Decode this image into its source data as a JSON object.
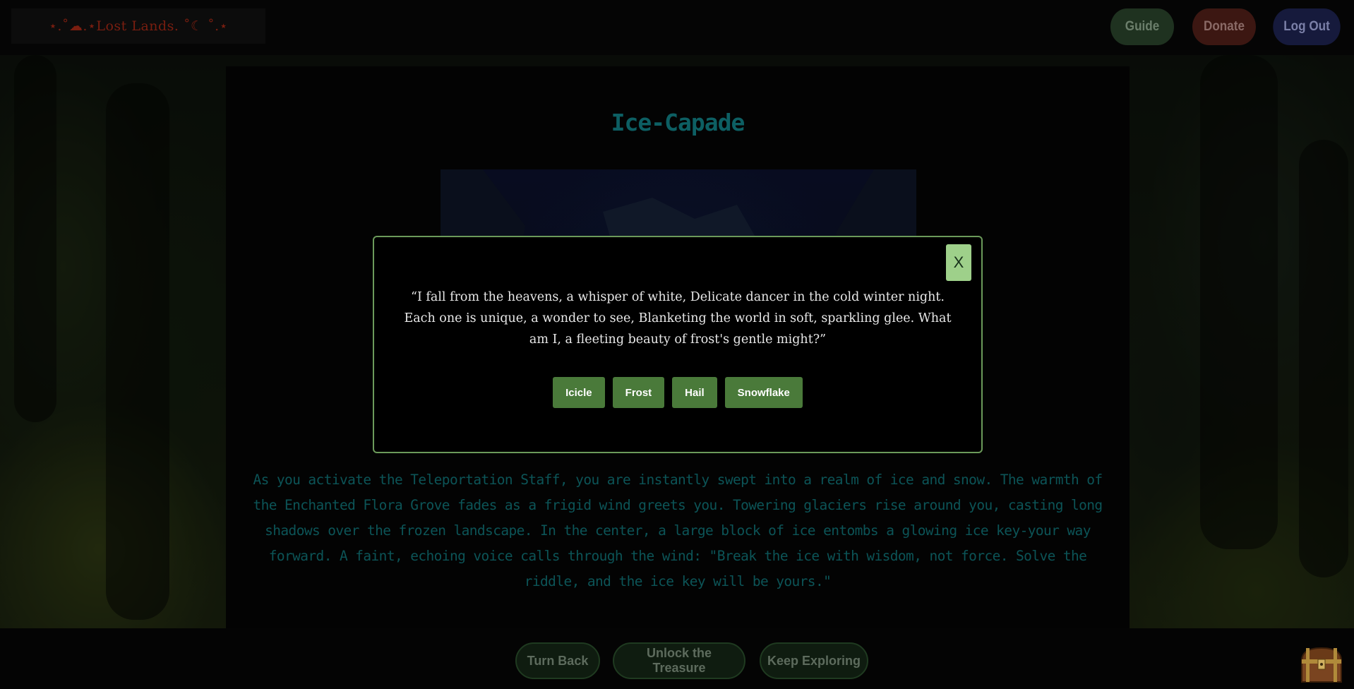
{
  "header": {
    "logo_text": "⋆.˚☁︎.⋆Lost Lands. ˚☾ ˚.⋆",
    "nav": {
      "guide": "Guide",
      "donate": "Donate",
      "logout": "Log Out"
    }
  },
  "main": {
    "title": "Ice-Capade",
    "story": "As you activate the Teleportation Staff, you are instantly swept into a realm of ice and snow. The warmth of the Enchanted Flora Grove fades as a frigid wind greets you. Towering glaciers rise around you, casting long shadows over the frozen landscape. In the center, a large block of ice entombs a glowing ice key-your way forward. A faint, echoing voice calls through the wind: \"Break the ice with wisdom, not force. Solve the riddle, and the ice key will be yours.\""
  },
  "modal": {
    "close_label": "X",
    "riddle": "“I fall from the heavens, a whisper of white, Delicate dancer in the cold winter night. Each one is unique, a wonder to see, Blanketing the world in soft, sparkling glee. What am I, a fleeting beauty of frost's gentle might?”",
    "answers": [
      "Icicle",
      "Frost",
      "Hail",
      "Snowflake"
    ]
  },
  "footer": {
    "buttons": [
      "Turn Back",
      "Unlock the Treasure",
      "Keep Exploring"
    ],
    "chest_icon": "treasure-chest-icon"
  },
  "colors": {
    "accent_green": "#4a7a3a",
    "title_teal": "#0d5f63",
    "logo_red": "#7a1e10"
  }
}
